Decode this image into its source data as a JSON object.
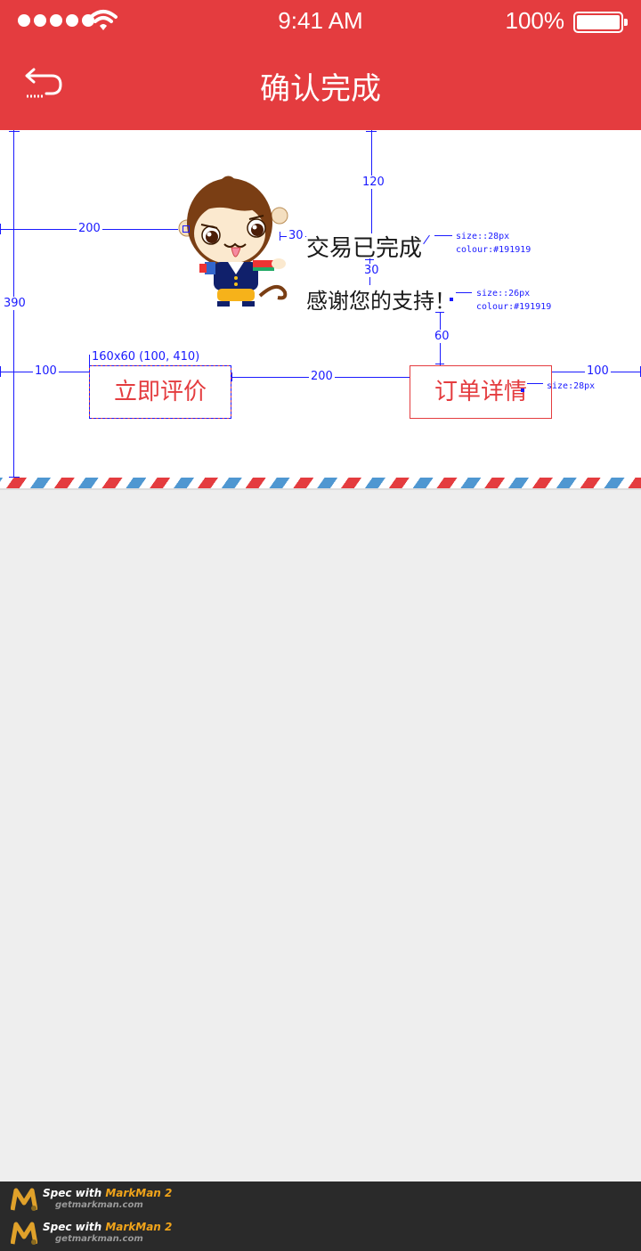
{
  "status_bar": {
    "time": "9:41 AM",
    "battery": "100%"
  },
  "nav": {
    "title": "确认完成"
  },
  "content": {
    "message_title": "交易已完成",
    "message_sub": "感谢您的支持！",
    "btn_review": "立即评价",
    "btn_order": "订单详情"
  },
  "annotations": {
    "dim_left": "200",
    "dim_top": "120",
    "dim_gap_img": "30",
    "dim_gap_text": "30",
    "dim_height": "390",
    "dim_60": "60",
    "dim_btn_left": "100",
    "dim_btn_gap": "200",
    "dim_btn_right": "100",
    "spec1_size": "size::28px",
    "spec1_colour": "colour:#191919",
    "spec2_size": "size::26px",
    "spec2_colour": "colour:#191919",
    "btn_box": "160x60 (100, 410)",
    "spec3_size": "size:28px"
  },
  "footer": {
    "prefix": "Spec with",
    "brand": "MarkMan 2",
    "site": "getmarkman.com"
  },
  "colors": {
    "primary": "#e43c3f",
    "text": "#191919",
    "annotation": "#1a1aff",
    "background": "#eeeeee"
  }
}
